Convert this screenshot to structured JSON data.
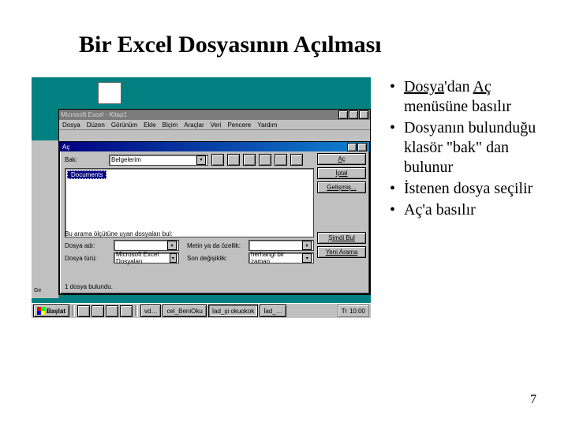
{
  "title": "Bir Excel Dosyasının Açılması",
  "bullets": [
    {
      "pre": "",
      "u1": "Dosya",
      "mid": "'dan ",
      "u2": "Aç",
      "post": " menüsüne basılır"
    },
    {
      "pre": "Dosyanın bulunduğu klasör \"bak\" dan bulunur",
      "u1": "",
      "mid": "",
      "u2": "",
      "post": ""
    },
    {
      "pre": "İstenen dosya seçilir",
      "u1": "",
      "mid": "",
      "u2": "",
      "post": ""
    },
    {
      "pre": "Aç'a basılır",
      "u1": "",
      "mid": "",
      "u2": "",
      "post": ""
    }
  ],
  "page_number": "7",
  "excel": {
    "title": "Microsoft Excel - Kitap1",
    "menu": [
      "Dosya",
      "Düzen",
      "Görünüm",
      "Ekle",
      "Biçim",
      "Araçlar",
      "Veri",
      "Pencere",
      "Yardım"
    ]
  },
  "dialog": {
    "title": "Aç",
    "look_in_label": "Bak:",
    "look_in_value": "Belgelerim",
    "selected_file": "Documents",
    "buttons": {
      "open": "Aç",
      "cancel": "İptal",
      "advanced": "Gelişmiş..."
    },
    "find_caption": "Bu arama ölçütüne uyan dosyaları bul:",
    "filename_label": "Dosya adı:",
    "filename_value": "",
    "text_label": "Metin ya da özellik:",
    "text_value": "",
    "type_label": "Dosya türü:",
    "type_value": "Microsoft Excel Dosyaları",
    "modified_label": "Son değişiklik:",
    "modified_value": "herhangi bir zaman",
    "find_now": "Şimdi Bul",
    "new_search": "Yeni Arama",
    "status": "1 dosya bulundu."
  },
  "leftbar_label": "Ge",
  "taskbar": {
    "start": "Başlat",
    "items": [
      "vd…",
      "cel_BeniOku",
      "İad_şi okuokok",
      "İad_…"
    ],
    "tray_lang": "Tr",
    "clock": "10:00"
  }
}
